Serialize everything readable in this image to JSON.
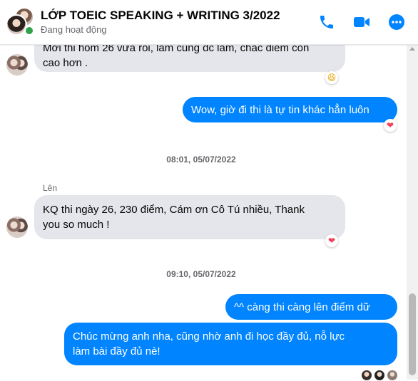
{
  "header": {
    "title": "LỚP TOEIC SPEAKING + WRITING 3/2022",
    "status": "Đang hoạt động",
    "icons": [
      "phone-icon",
      "video-camera-icon",
      "more-options-icon"
    ],
    "accent_color": "#0084ff"
  },
  "messages": [
    {
      "direction": "incoming",
      "text_line1": "Mới thi hôm 26 vừa rồi, làm cũng đc lắm, chắc điểm còn",
      "text_line2": "cao hơn .",
      "reaction": "😆"
    },
    {
      "direction": "outgoing",
      "text": "Wow, giờ đi thi là tự tin khác hẳn luôn",
      "reaction": "❤"
    },
    {
      "type": "timestamp",
      "text": "08:01, 05/07/2022"
    },
    {
      "sender": "Lên",
      "direction": "incoming",
      "text_line1": "KQ thi ngày 26, 230 điểm, Cám ơn Cô Tú nhiều, Thank",
      "text_line2": "you so much !",
      "reaction": "❤"
    },
    {
      "type": "timestamp",
      "text": "09:10, 05/07/2022"
    },
    {
      "direction": "outgoing",
      "text": "^^ càng thi càng lên điểm dữ"
    },
    {
      "direction": "outgoing",
      "text_line1": "Chúc mừng anh nha, cũng nhờ anh đi học đầy đủ, nỗ lực",
      "text_line2": "làm bài đầy đủ nè!"
    }
  ],
  "colors": {
    "outgoing_bubble": "#0084ff",
    "incoming_bubble": "#e4e6eb",
    "heart": "#f33e58",
    "online": "#31a24c"
  }
}
